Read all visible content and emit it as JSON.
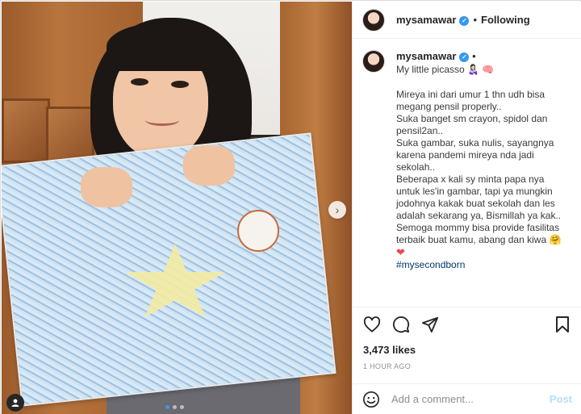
{
  "header": {
    "username": "mysamawar",
    "separator": "•",
    "follow_label": "Following"
  },
  "caption": {
    "username": "mysamawar",
    "separator": "•",
    "lines": [
      "My little picasso 👩🏻‍🍼 🧠",
      "",
      "Mireya ini dari umur 1 thn udh bisa megang pensil properly..",
      "Suka banget sm crayon, spidol dan pensil2an..",
      "Suka gambar, suka nulis, sayangnya karena pandemi mireya nda jadi sekolah..",
      "Beberapa x kali sy minta papa nya untuk les'in gambar, tapi ya mungkin jodohnya kakak buat sekolah dan les adalah sekarang ya, Bismillah ya kak..",
      "Semoga mommy bisa provide fasilitas terbaik buat kamu, abang dan kiwa 🤗"
    ],
    "heart": "❤",
    "hashtag": "#mysecondborn"
  },
  "likes": "3,473 likes",
  "time": "1 HOUR AGO",
  "comment": {
    "placeholder": "Add a comment...",
    "post_label": "Post"
  },
  "colors": {
    "accent": "#3897f0",
    "heart": "#ed4956",
    "post_disabled": "#b2dffc"
  }
}
